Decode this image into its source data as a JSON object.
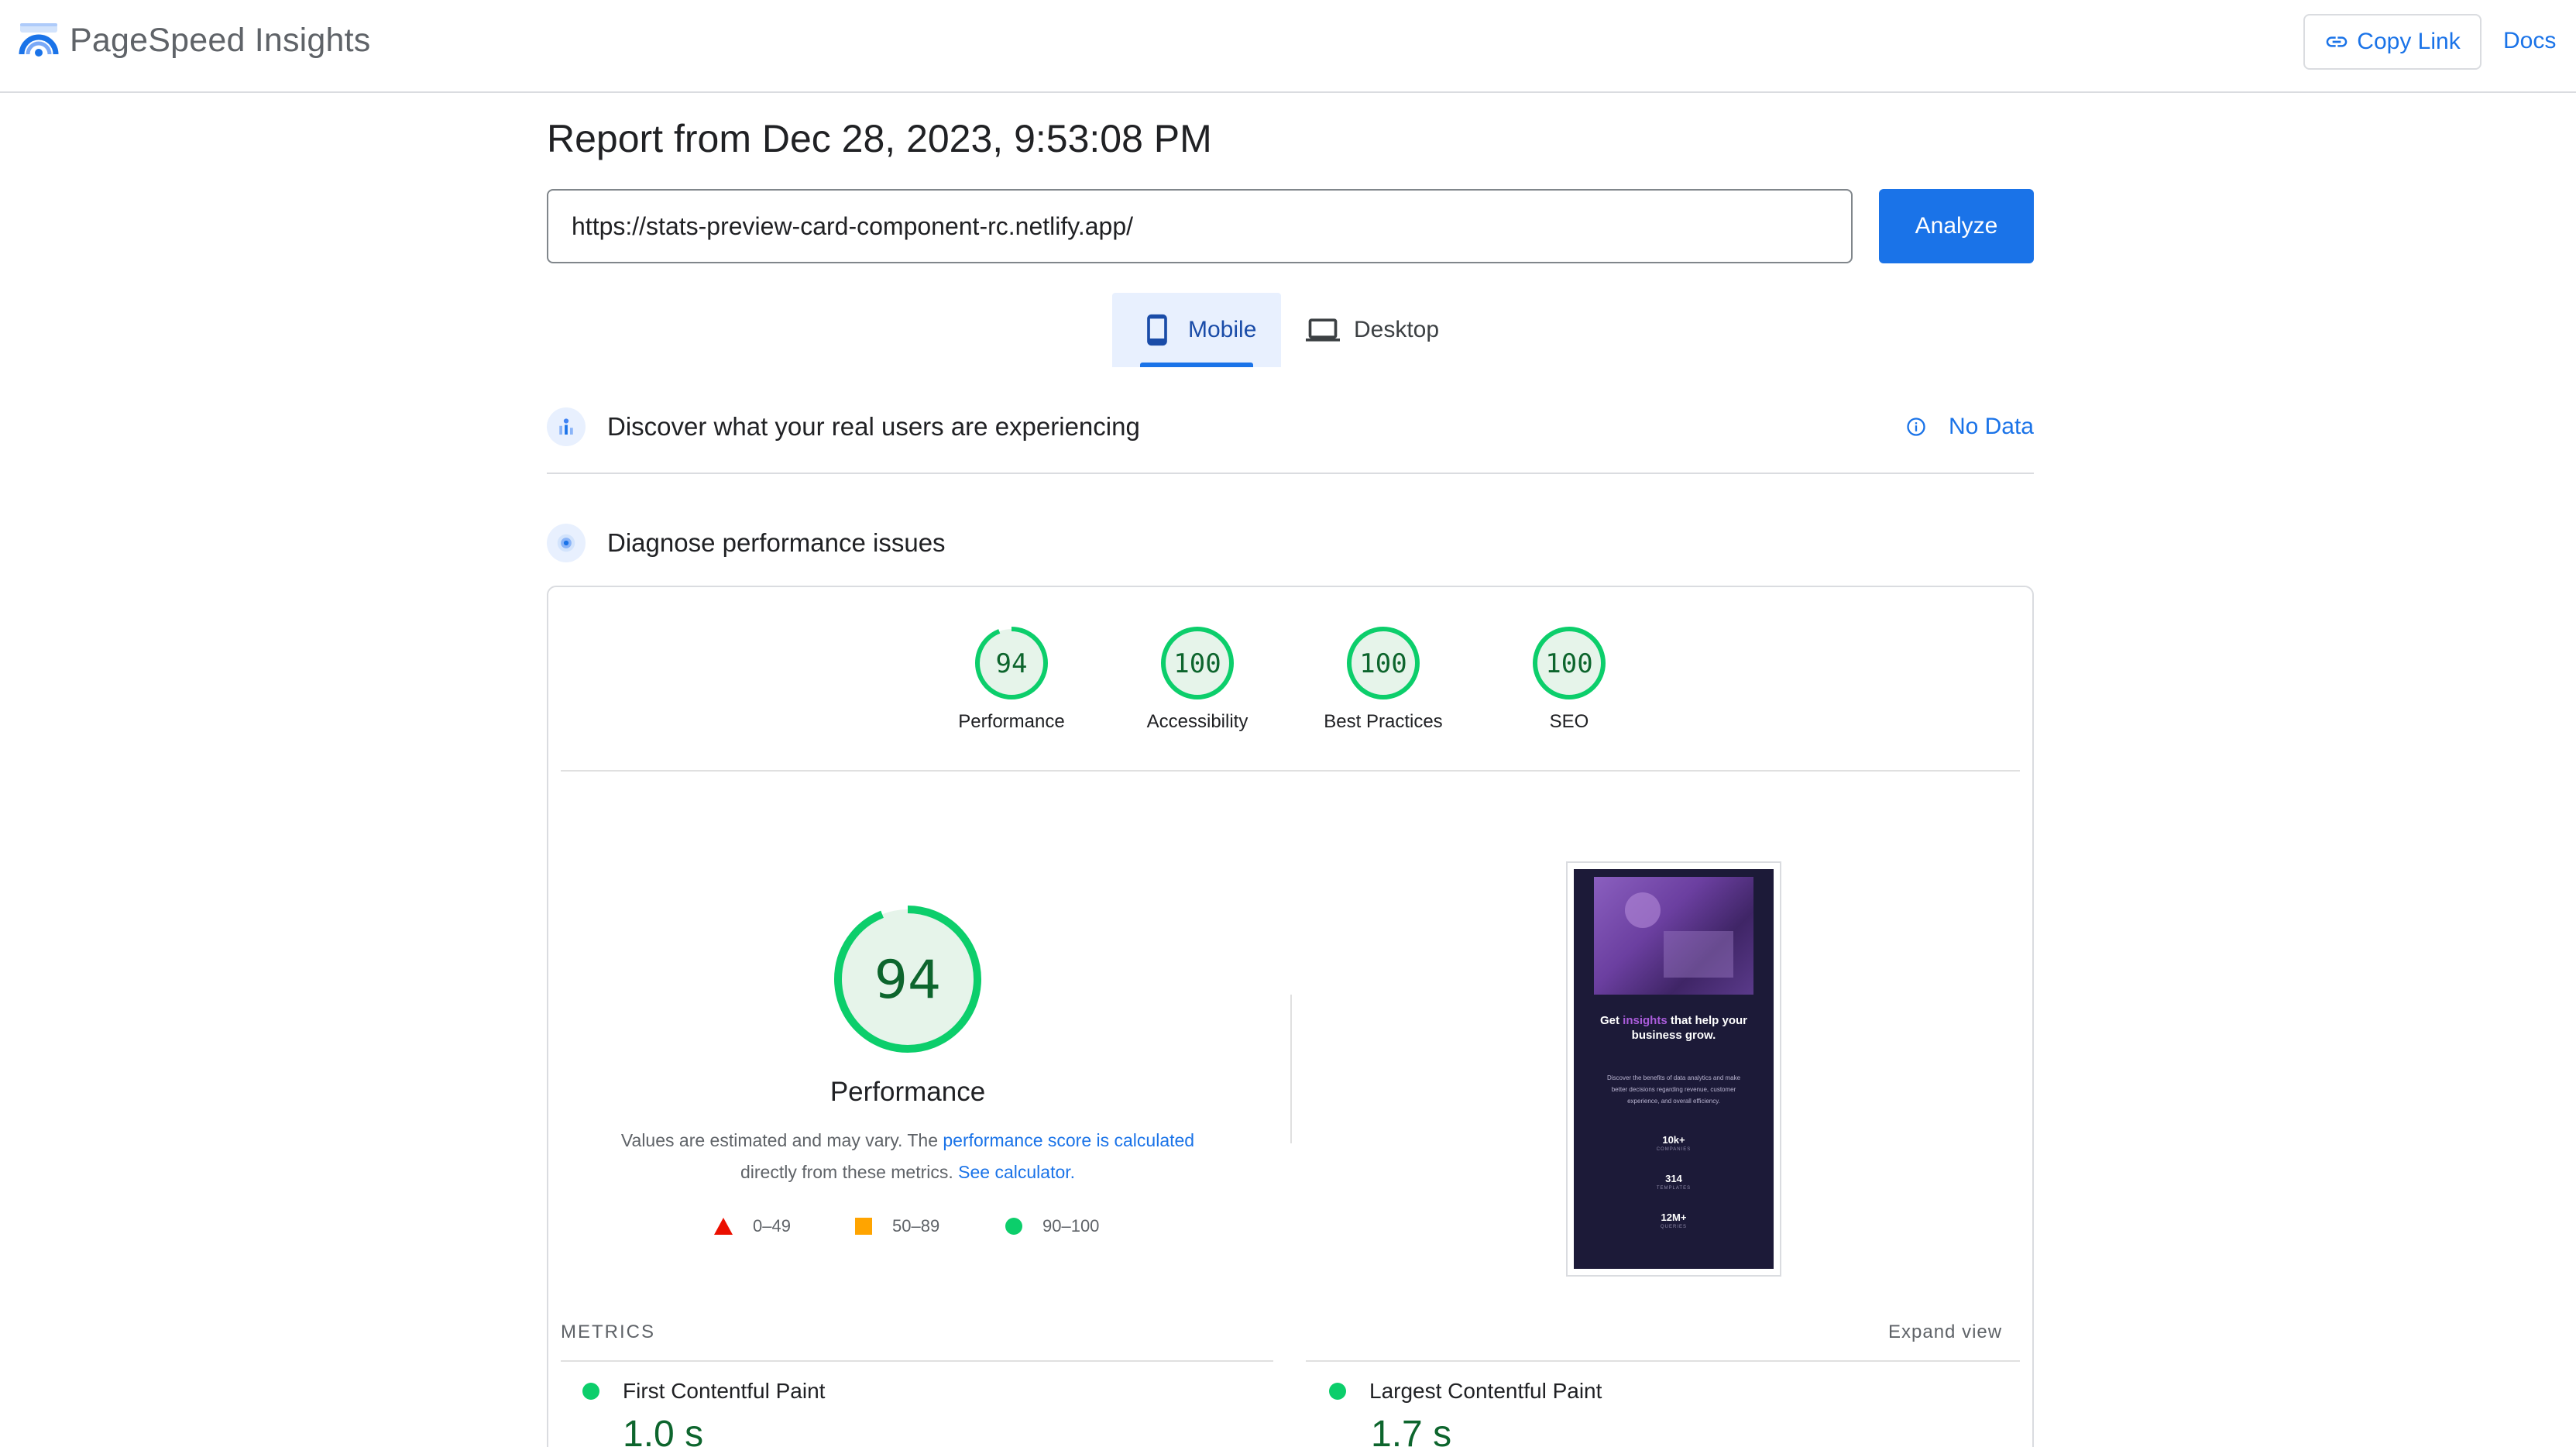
{
  "header": {
    "app_name": "PageSpeed Insights",
    "logo_icon": "pagespeed-logo-icon",
    "copy_link_label": "Copy Link",
    "docs_label": "Docs"
  },
  "report": {
    "title": "Report from Dec 28, 2023, 9:53:08 PM",
    "url_value": "https://stats-preview-card-component-rc.netlify.app/",
    "analyze_label": "Analyze"
  },
  "tabs": {
    "mobile": "Mobile",
    "desktop": "Desktop",
    "selected": "Mobile"
  },
  "discover": {
    "title": "Discover what your real users are experiencing",
    "no_data_label": "No Data"
  },
  "diagnose": {
    "title": "Diagnose performance issues"
  },
  "scores": [
    {
      "label": "Performance",
      "value": "94",
      "score": 94
    },
    {
      "label": "Accessibility",
      "value": "100",
      "score": 100
    },
    {
      "label": "Best Practices",
      "value": "100",
      "score": 100
    },
    {
      "label": "SEO",
      "value": "100",
      "score": 100
    }
  ],
  "performance": {
    "score": "94",
    "score_fraction": 0.94,
    "title": "Performance",
    "desc_prefix": "Values are estimated and may vary. The ",
    "desc_link1": "performance score is calculated",
    "desc_middle": " directly from these metrics. ",
    "desc_link2": "See calculator.",
    "legend": [
      {
        "range": "0–49",
        "shape": "triangle",
        "color": "#eb0f00"
      },
      {
        "range": "50–89",
        "shape": "square",
        "color": "#ffa400"
      },
      {
        "range": "90–100",
        "shape": "circle",
        "color": "#0cce6b"
      }
    ]
  },
  "screenshot": {
    "heading_before": "Get ",
    "heading_highlight": "insights",
    "heading_after": " that help your business grow.",
    "body": "Discover the benefits of data analytics and make better decisions regarding revenue, customer experience, and overall efficiency.",
    "stats": [
      {
        "value": "10k+",
        "label": "COMPANIES"
      },
      {
        "value": "314",
        "label": "TEMPLATES"
      },
      {
        "value": "12M+",
        "label": "QUERIES"
      }
    ]
  },
  "metrics": {
    "section_label": "METRICS",
    "expand_label": "Expand view",
    "items": [
      {
        "name": "First Contentful Paint",
        "value": "1.0 s"
      },
      {
        "name": "Largest Contentful Paint",
        "value": "1.7 s"
      }
    ]
  },
  "colors": {
    "accent": "#1a73e8",
    "pass_green": "#0cce6b",
    "pass_text": "#0d652d",
    "gauge_fill": "#e6f4ea"
  }
}
